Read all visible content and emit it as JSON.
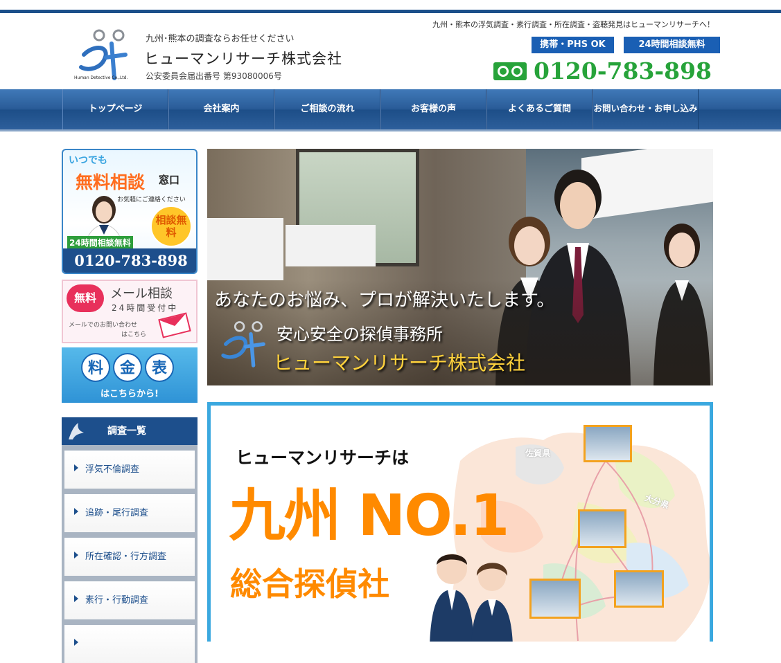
{
  "header": {
    "top_note": "九州・熊本の浮気調査・素行調査・所在調査・盗聴発見はヒューマンリサーチへ！",
    "tagline": "九州･熊本の調査ならお任せください",
    "company": "ヒューマンリサーチ株式会社",
    "license": "公安委員会届出番号 第93080006号",
    "logo_caption": "Human Detective Co.,Ltd.",
    "badge_mobile": "携帯・PHS OK",
    "badge_24h": "24時間相談無料",
    "phone": "0120-783-898"
  },
  "nav": {
    "items": [
      {
        "label": "トップページ"
      },
      {
        "label": "会社案内"
      },
      {
        "label": "ご相談の流れ"
      },
      {
        "label": "お客様の声"
      },
      {
        "label": "よくあるご質問"
      },
      {
        "label": "お問い合わせ・お申し込み"
      }
    ]
  },
  "sidebar": {
    "free_banner": {
      "line1": "いつでも",
      "line2": "無料相談",
      "line3": "窓口",
      "line4": "お気軽にご連絡ください",
      "circle": "相談無料",
      "line5": "24時間相談無料",
      "phone": "0120-783-898"
    },
    "mail_banner": {
      "badge": "無料",
      "title": "メール相談",
      "sub": "24時間受付中",
      "note1": "メールでのお問い合わせ",
      "note2": "はこちら"
    },
    "price_banner": {
      "chars": [
        "料",
        "金",
        "表"
      ],
      "sub": "はこちらから!"
    },
    "menu": {
      "title": "調査一覧",
      "items": [
        {
          "label": "浮気不倫調査"
        },
        {
          "label": "追跡・尾行調査"
        },
        {
          "label": "所在確認・行方調査"
        },
        {
          "label": "素行・行動調査"
        }
      ]
    }
  },
  "hero": {
    "headline": "あなたのお悩み、プロが解決いたします。",
    "sub": "安心安全の探偵事務所",
    "company": "ヒューマンリサーチ株式会社"
  },
  "promo": {
    "line1": "ヒューマンリサーチは",
    "line2": "九州 NO.1",
    "line3": "総合探偵社",
    "pref1": "佐賀県",
    "pref2": "大分県"
  },
  "colors": {
    "brand_blue": "#1d4f8c",
    "accent_green": "#27a33a",
    "accent_orange": "#ff8a00",
    "sky": "#3aa8df"
  }
}
